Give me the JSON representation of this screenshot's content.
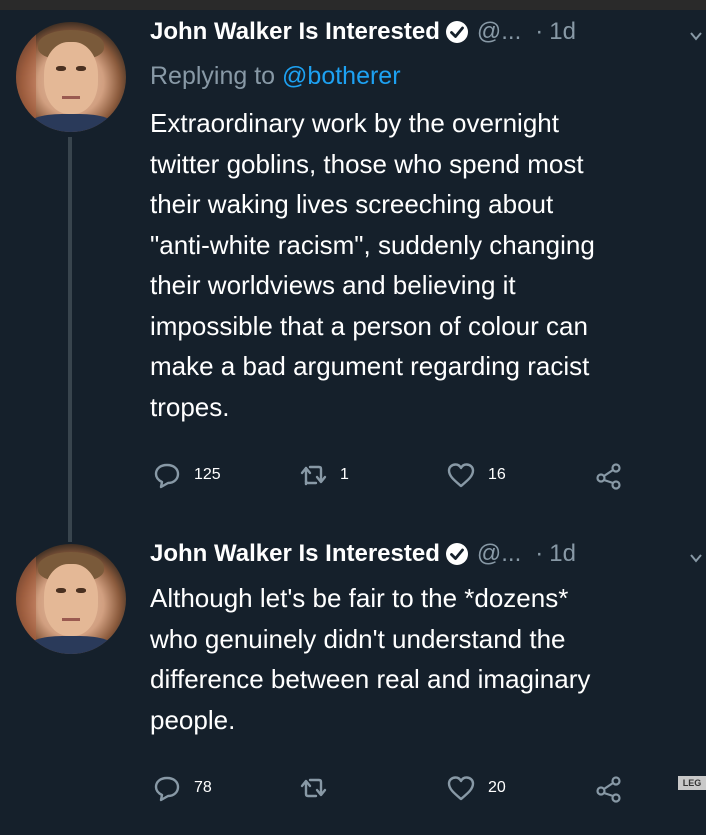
{
  "tweets": [
    {
      "author_name": "John Walker Is Interested",
      "handle": "@...",
      "dot": "·",
      "time": "1d",
      "replying_prefix": "Replying to ",
      "replying_to": "@botherer",
      "text_lines": [
        "Extraordinary work by the overnight",
        "twitter goblins, those who spend most",
        "their waking lives screeching about",
        "\"anti-white racism\", suddenly changing",
        "their worldviews and believing it",
        "impossible that a person of colour can",
        "make a bad argument regarding racist",
        "tropes."
      ],
      "reply_count": "125",
      "retweet_count": "1",
      "like_count": "16"
    },
    {
      "author_name": "John Walker Is Interested",
      "handle": "@...",
      "dot": "·",
      "time": "1d",
      "text_lines": [
        "Although let's be fair to the *dozens*",
        "who genuinely didn't understand the",
        "difference between real and imaginary",
        "people."
      ],
      "reply_count": "78",
      "retweet_count": "",
      "like_count": "20"
    }
  ],
  "icons": {
    "verified": "verified-badge-icon",
    "reply": "speech-bubble-icon",
    "retweet": "retweet-arrows-icon",
    "like": "heart-outline-icon",
    "share": "share-nodes-icon",
    "chevron": "chevron-down-icon"
  },
  "colors": {
    "background": "#15202b",
    "secondary_text": "#8899a6",
    "link": "#1da1f2",
    "thread_line": "#38444d"
  },
  "watermark_text": "LEG"
}
